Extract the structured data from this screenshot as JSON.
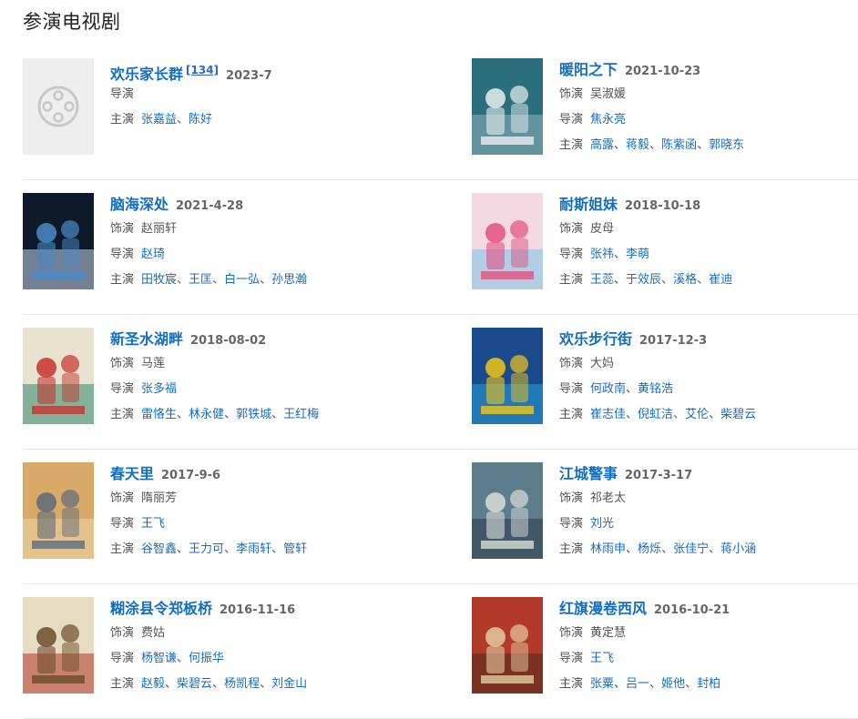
{
  "section_title": "参演电视剧",
  "labels": {
    "role": "饰演",
    "director": "导演",
    "cast": "主演",
    "sep": "、"
  },
  "colors": {
    "link": "#136ec2",
    "text": "#555555",
    "divider": "#e8e8e8"
  },
  "rows": [
    {
      "left": {
        "title": "欢乐家长群",
        "ref": "[134]",
        "date": "2023-7",
        "poster": "film-placeholder-icon",
        "role": "",
        "directors": [],
        "cast": [
          "张嘉益",
          "陈好"
        ]
      },
      "right": {
        "title": "暖阳之下",
        "ref": "",
        "date": "2021-10-23",
        "poster": "poster-image",
        "role": "吴淑媛",
        "directors": [
          "焦永亮"
        ],
        "cast": [
          "高露",
          "蒋毅",
          "陈紫函",
          "郭晓东"
        ]
      }
    },
    {
      "left": {
        "title": "脑海深处",
        "ref": "",
        "date": "2021-4-28",
        "poster": "poster-image",
        "role": "赵丽轩",
        "directors": [
          "赵琦"
        ],
        "cast": [
          "田牧宸",
          "王匡",
          "白一弘",
          "孙思瀚"
        ]
      },
      "right": {
        "title": "耐斯姐妹",
        "ref": "",
        "date": "2018-10-18",
        "poster": "poster-image",
        "role": "皮母",
        "directors": [
          "张祎",
          "李萌"
        ],
        "cast": [
          "王蕊",
          "于效辰",
          "溪格",
          "崔迪"
        ]
      }
    },
    {
      "left": {
        "title": "新圣水湖畔",
        "ref": "",
        "date": "2018-08-02",
        "poster": "poster-image",
        "role": "马莲",
        "directors": [
          "张多福"
        ],
        "cast": [
          "雷恪生",
          "林永健",
          "郭铁城",
          "王红梅"
        ]
      },
      "right": {
        "title": "欢乐步行街",
        "ref": "",
        "date": "2017-12-3",
        "poster": "poster-image",
        "role": "大妈",
        "directors": [
          "何政南",
          "黄铭浩"
        ],
        "cast": [
          "崔志佳",
          "倪虹洁",
          "艾伦",
          "柴碧云"
        ]
      }
    },
    {
      "left": {
        "title": "春天里",
        "ref": "",
        "date": "2017-9-6",
        "poster": "poster-image",
        "role": "隋丽芳",
        "directors": [
          "王飞"
        ],
        "cast": [
          "谷智鑫",
          "王力可",
          "李雨轩",
          "管轩"
        ]
      },
      "right": {
        "title": "江城警事",
        "ref": "",
        "date": "2017-3-17",
        "poster": "poster-image",
        "role": "祁老太",
        "directors": [
          "刘光"
        ],
        "cast": [
          "林雨申",
          "杨烁",
          "张佳宁",
          "蒋小涵"
        ]
      }
    },
    {
      "left": {
        "title": "糊涂县令郑板桥",
        "ref": "",
        "date": "2016-11-16",
        "poster": "poster-image",
        "role": "费姑",
        "directors": [
          "杨智谦",
          "何振华"
        ],
        "cast": [
          "赵毅",
          "柴碧云",
          "杨凯程",
          "刘金山"
        ]
      },
      "right": {
        "title": "红旗漫卷西风",
        "ref": "",
        "date": "2016-10-21",
        "poster": "poster-image",
        "role": "黄定慧",
        "directors": [
          "王飞"
        ],
        "cast": [
          "张粟",
          "吕一",
          "姬他",
          "封柏"
        ]
      }
    }
  ]
}
